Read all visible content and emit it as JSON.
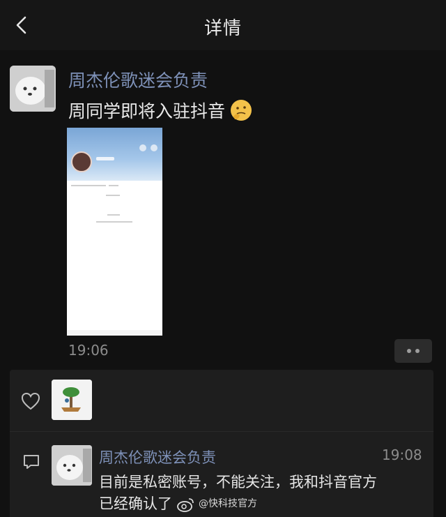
{
  "header": {
    "title": "详情",
    "back_icon": "chevron-left-icon"
  },
  "post": {
    "author": "周杰伦歌迷会负责",
    "text": "周同学即将入驻抖音",
    "emoji": "thinking-face-emoji",
    "time": "19:06"
  },
  "comment": {
    "author": "周杰伦歌迷会负责",
    "time": "19:08",
    "line1": "目前是私密账号，不能关注，我和抖音官方",
    "line2": "已经确认了",
    "watermark": "@快科技官方"
  },
  "colors": {
    "background": "#111111",
    "name": "#7e91b8",
    "panel": "#1e1e1e"
  }
}
